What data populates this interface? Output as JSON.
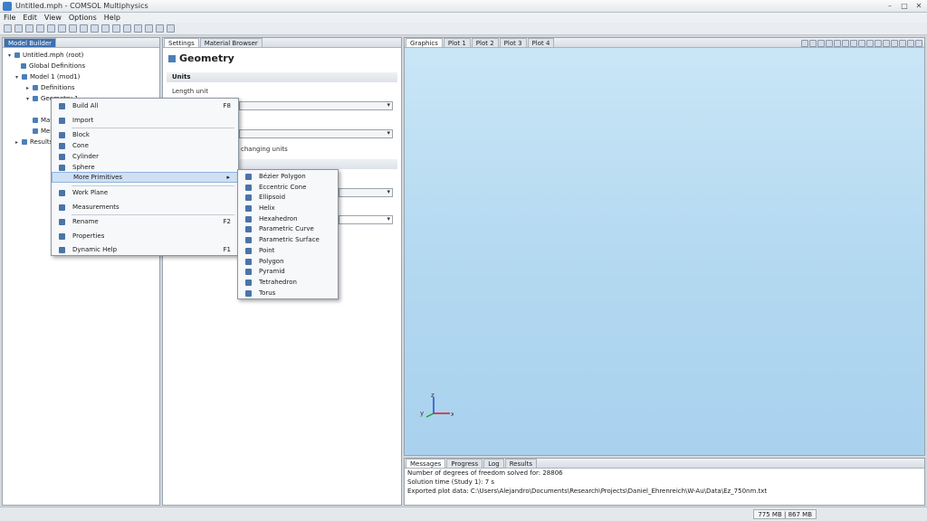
{
  "window": {
    "title": "Untitled.mph - COMSOL Multiphysics",
    "btn_min": "–",
    "btn_max": "□",
    "btn_close": "✕"
  },
  "menu": [
    "File",
    "Edit",
    "View",
    "Options",
    "Help"
  ],
  "model_builder": {
    "tab": "Model Builder",
    "tree": [
      {
        "label": "Untitled.mph (root)",
        "twisty": "▾"
      },
      {
        "label": "Global Definitions",
        "twisty": ""
      },
      {
        "label": "Model 1 (mod1)",
        "twisty": "▾"
      },
      {
        "label": "Definitions",
        "twisty": "▸"
      },
      {
        "label": "Geometry 1",
        "twisty": "▾"
      },
      {
        "label": "Materials",
        "twisty": ""
      },
      {
        "label": "Mesh 1",
        "twisty": ""
      },
      {
        "label": "Results",
        "twisty": "▸"
      }
    ]
  },
  "settings": {
    "tabs": [
      "Settings",
      "Material Browser"
    ],
    "title": "Geometry",
    "units_section": "Units",
    "length_unit_label": "Length unit",
    "changing_units": "changing units"
  },
  "graphics": {
    "tabs": [
      "Graphics",
      "Plot 1",
      "Plot 2",
      "Plot 3",
      "Plot 4"
    ],
    "axes": {
      "x": "x",
      "y": "y",
      "z": "z"
    }
  },
  "context_menu": {
    "items": [
      {
        "label": "Build All",
        "shortcut": "F8"
      },
      {
        "label": "Import",
        "shortcut": ""
      },
      {
        "label": "Block",
        "shortcut": ""
      },
      {
        "label": "Cone",
        "shortcut": ""
      },
      {
        "label": "Cylinder",
        "shortcut": ""
      },
      {
        "label": "Sphere",
        "shortcut": ""
      },
      {
        "label": "More Primitives",
        "shortcut": "▸"
      },
      {
        "label": "Work Plane",
        "shortcut": ""
      },
      {
        "label": "Measurements",
        "shortcut": ""
      },
      {
        "label": "Rename",
        "shortcut": "F2"
      },
      {
        "label": "Properties",
        "shortcut": ""
      },
      {
        "label": "Dynamic Help",
        "shortcut": "F1"
      }
    ]
  },
  "submenu": {
    "items": [
      "Bézier Polygon",
      "Eccentric Cone",
      "Ellipsoid",
      "Helix",
      "Hexahedron",
      "Parametric Curve",
      "Parametric Surface",
      "Point",
      "Polygon",
      "Pyramid",
      "Tetrahedron",
      "Torus"
    ]
  },
  "messages": {
    "tabs": [
      "Messages",
      "Progress",
      "Log",
      "Results"
    ],
    "lines": [
      "Number of degrees of freedom solved for: 28806",
      "Solution time (Study 1): 7 s",
      "Exported plot data: C:\\Users\\Alejandro\\Documents\\Research\\Projects\\Daniel_Ehrenreich\\W-Au\\Data\\Ez_750nm.txt"
    ]
  },
  "status": {
    "memory": "775 MB | 867 MB"
  },
  "colors": {
    "graphics_top": "#c9e6f6",
    "graphics_bottom": "#a9d1ee",
    "axis_x": "#d02020",
    "axis_y": "#20a020",
    "axis_z": "#2040d0"
  }
}
